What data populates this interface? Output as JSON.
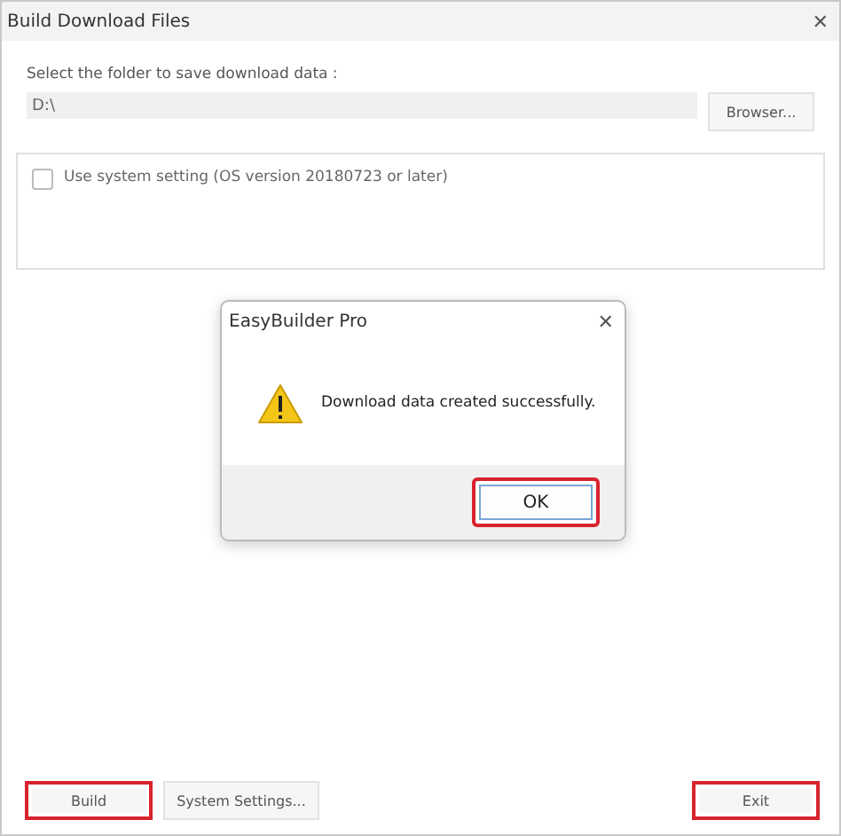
{
  "window": {
    "title": "Build Download Files",
    "close": "✕"
  },
  "folder": {
    "label": "Select the folder to save download data :",
    "value": "D:\\",
    "browse": "Browser..."
  },
  "system_setting": {
    "label": "Use system setting (OS version 20180723 or later)",
    "checked": false
  },
  "left_buttons": [
    {
      "label": "Build",
      "highlighted": true
    },
    {
      "label": "System Settings...",
      "highlighted": false
    }
  ],
  "right_buttons": [
    {
      "label": "Exit",
      "highlighted": true
    }
  ],
  "dialog": {
    "title": "EasyBuilder Pro",
    "close": "✕",
    "message": "Download data created successfully.",
    "ok": {
      "label": "OK",
      "highlighted": true
    }
  }
}
